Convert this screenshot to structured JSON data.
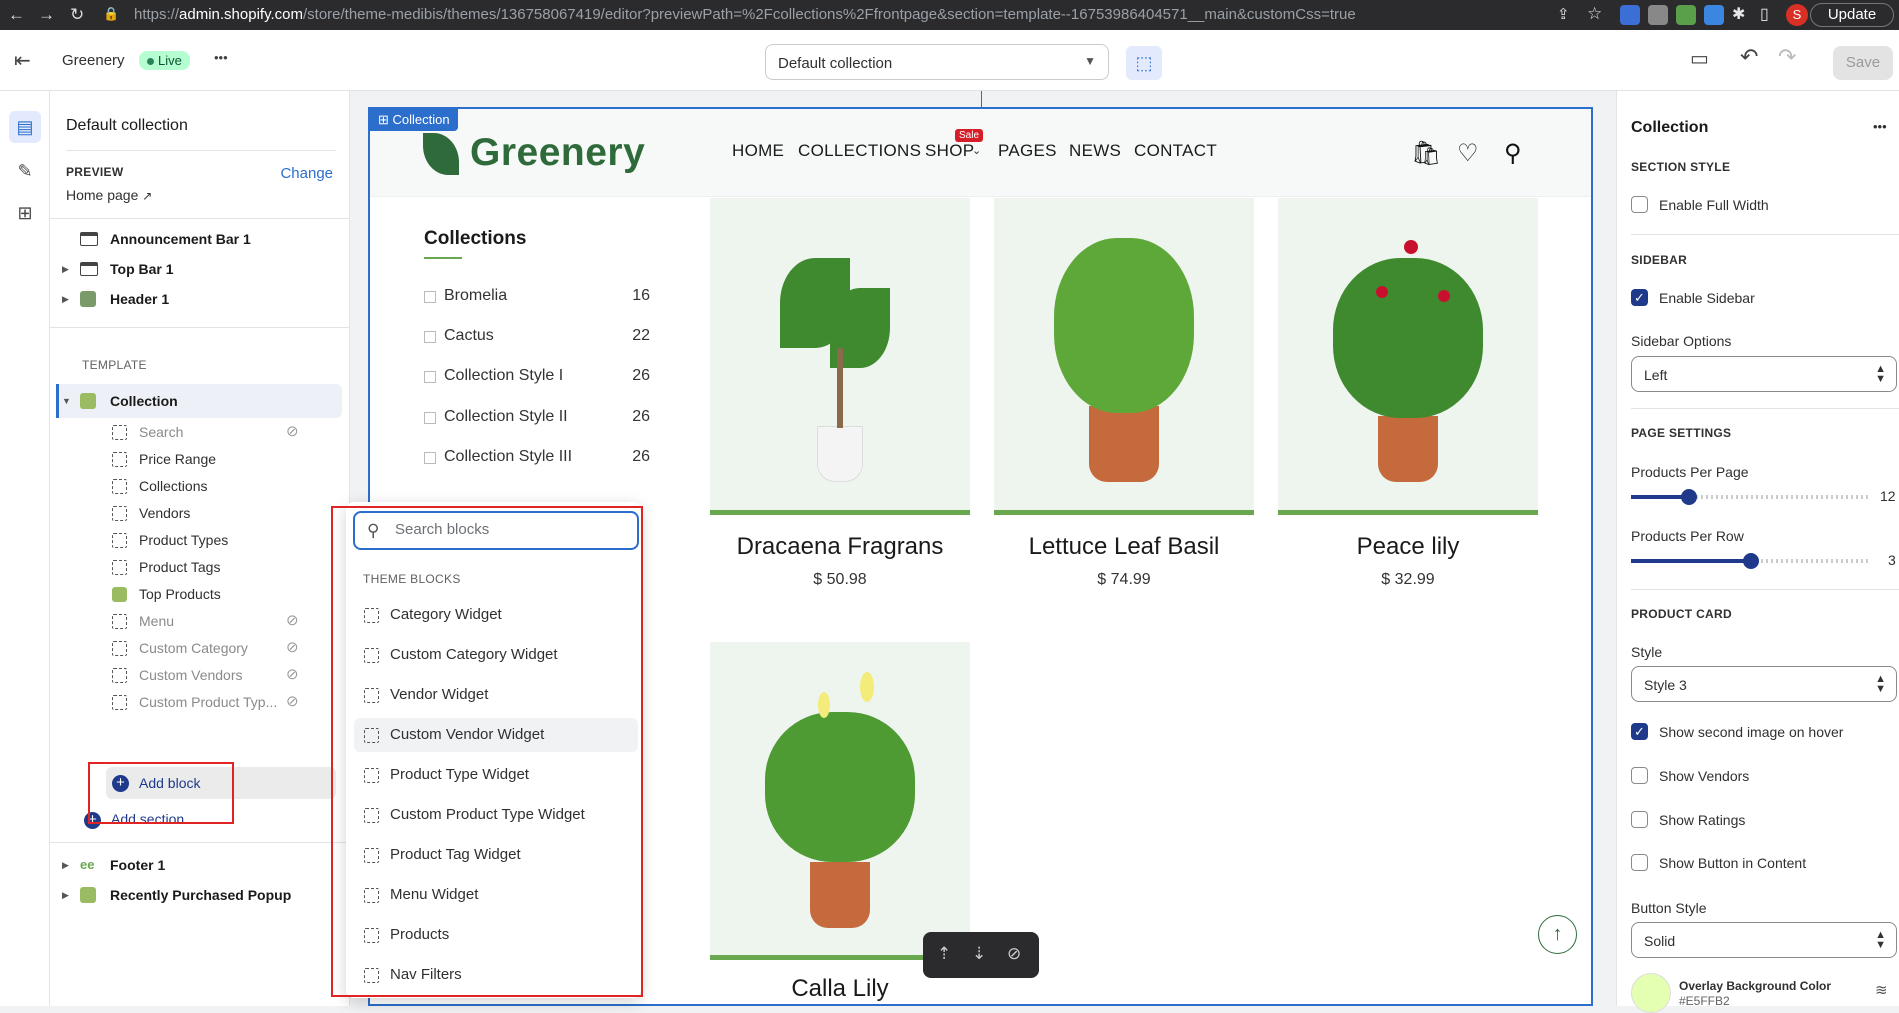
{
  "browser": {
    "url_prefix": "https://",
    "url_domain": "admin.shopify.com",
    "url_rest": "/store/theme-medibis/themes/136758067419/editor?previewPath=%2Fcollections%2Ffrontpage&section=template--16753986404571__main&customCss=true",
    "profile_initial": "S",
    "update_label": "Update"
  },
  "topbar": {
    "store_name": "Greenery",
    "live_label": "Live",
    "more_label": "•••",
    "template_value": "Default collection",
    "save_label": "Save"
  },
  "left_panel": {
    "title": "Default collection",
    "preview_label": "PREVIEW",
    "change_label": "Change",
    "preview_page": "Home page",
    "header_sections": [
      "Announcement Bar 1",
      "Top Bar 1",
      "Header 1"
    ],
    "template_label": "TEMPLATE",
    "collection_section": "Collection",
    "blocks": [
      {
        "label": "Search",
        "hidden": true
      },
      {
        "label": "Price Range",
        "hidden": false
      },
      {
        "label": "Collections",
        "hidden": false
      },
      {
        "label": "Vendors",
        "hidden": false
      },
      {
        "label": "Product Types",
        "hidden": false
      },
      {
        "label": "Product Tags",
        "hidden": false
      },
      {
        "label": "Top Products",
        "hidden": false
      },
      {
        "label": "Menu",
        "hidden": true
      },
      {
        "label": "Custom Category",
        "hidden": true
      },
      {
        "label": "Custom Vendors",
        "hidden": true
      },
      {
        "label": "Custom Product Typ...",
        "hidden": true
      }
    ],
    "add_block": "Add block",
    "add_section": "Add section",
    "footer_sections": [
      "Footer 1",
      "Recently Purchased Popup"
    ]
  },
  "block_picker": {
    "search_placeholder": "Search blocks",
    "group_label": "THEME BLOCKS",
    "items": [
      "Category Widget",
      "Custom Category Widget",
      "Vendor Widget",
      "Custom Vendor Widget",
      "Product Type Widget",
      "Custom Product Type Widget",
      "Product Tag Widget",
      "Menu Widget",
      "Products",
      "Nav Filters"
    ],
    "highlighted_item": "Custom Vendor Widget"
  },
  "preview": {
    "section_tag": "Collection",
    "logo_text": "Greenery",
    "nav": [
      "HOME",
      "COLLECTIONS",
      "SHOP",
      "PAGES",
      "NEWS",
      "CONTACT"
    ],
    "sale_badge": "Sale",
    "sidebar_title": "Collections",
    "categories": [
      {
        "name": "Bromelia",
        "count": "16"
      },
      {
        "name": "Cactus",
        "count": "22"
      },
      {
        "name": "Collection Style I",
        "count": "26"
      },
      {
        "name": "Collection Style II",
        "count": "26"
      },
      {
        "name": "Collection Style III",
        "count": "26"
      }
    ],
    "products": [
      {
        "name": "Dracaena Fragrans",
        "price": "$ 50.98"
      },
      {
        "name": "Lettuce Leaf Basil",
        "price": "$ 74.99"
      },
      {
        "name": "Peace lily",
        "price": "$ 32.99"
      },
      {
        "name": "Calla Lily",
        "price": ""
      }
    ]
  },
  "right_panel": {
    "title": "Collection",
    "more_label": "•••",
    "section_style_h": "SECTION STYLE",
    "enable_full_width": {
      "label": "Enable Full Width",
      "checked": false
    },
    "sidebar_h": "SIDEBAR",
    "enable_sidebar": {
      "label": "Enable Sidebar",
      "checked": true
    },
    "sidebar_options_label": "Sidebar Options",
    "sidebar_options_value": "Left",
    "page_settings_h": "PAGE SETTINGS",
    "products_per_page_label": "Products Per Page",
    "products_per_page": {
      "value": "12",
      "fraction": 0.24
    },
    "products_per_row_label": "Products Per Row",
    "products_per_row": {
      "value": "3",
      "fraction": 0.5
    },
    "product_card_h": "PRODUCT CARD",
    "style_label": "Style",
    "style_value": "Style 3",
    "show_second_image": {
      "label": "Show second image on hover",
      "checked": true
    },
    "show_vendors": {
      "label": "Show Vendors",
      "checked": false
    },
    "show_ratings": {
      "label": "Show Ratings",
      "checked": false
    },
    "show_button": {
      "label": "Show Button in Content",
      "checked": false
    },
    "button_style_label": "Button Style",
    "button_style_value": "Solid",
    "overlay_label": "Overlay Background Color",
    "overlay_value": "#E5FFB2",
    "overlay_color": "#E5FFB2"
  },
  "colors": {
    "accent": "#2c6ecb",
    "brand_green": "#2f6b3a",
    "highlight_red": "#e02424"
  }
}
